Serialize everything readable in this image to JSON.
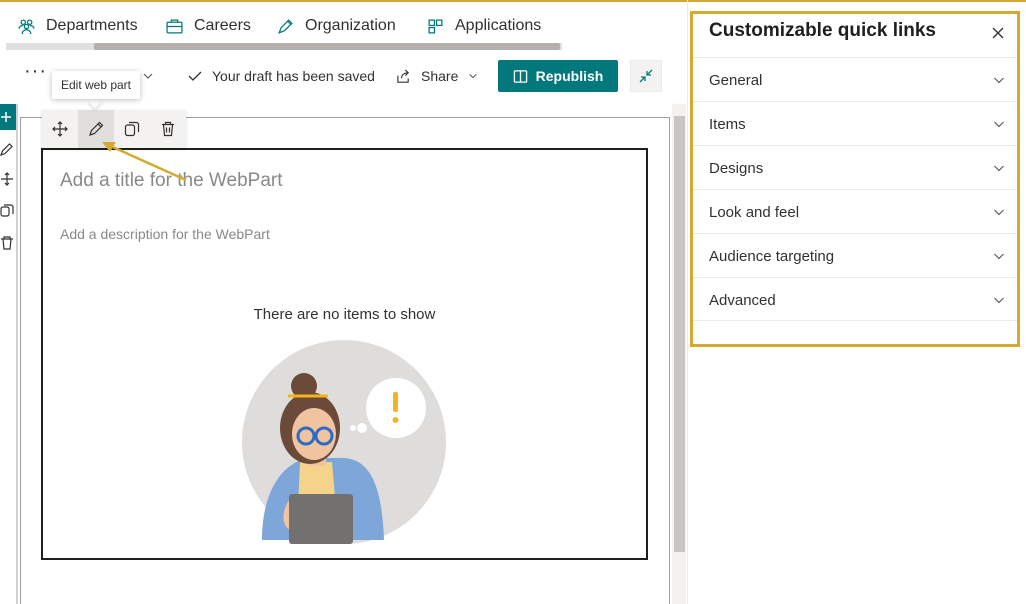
{
  "nav": {
    "items": [
      {
        "label": "Departments",
        "icon": "people-icon"
      },
      {
        "label": "Careers",
        "icon": "briefcase-icon"
      },
      {
        "label": "Organization",
        "icon": "pen-icon"
      },
      {
        "label": "Applications",
        "icon": "apps-icon"
      }
    ]
  },
  "commandbar": {
    "more_label": "···",
    "draft_status": "Your draft has been saved",
    "share_label": "Share",
    "republish_label": "Republish"
  },
  "tooltip": {
    "text": "Edit web part"
  },
  "webpart": {
    "title_placeholder": "Add a title for the WebPart",
    "description_placeholder": "Add a description for the WebPart",
    "empty_message": "There are no items to show"
  },
  "panel": {
    "title": "Customizable quick links",
    "sections": [
      {
        "label": "General"
      },
      {
        "label": "Items"
      },
      {
        "label": "Designs"
      },
      {
        "label": "Look and feel"
      },
      {
        "label": "Audience targeting"
      },
      {
        "label": "Advanced"
      }
    ]
  },
  "colors": {
    "accent": "#03787c",
    "highlight": "#d4ab2e",
    "text": "#323130",
    "muted": "#8a8886"
  }
}
